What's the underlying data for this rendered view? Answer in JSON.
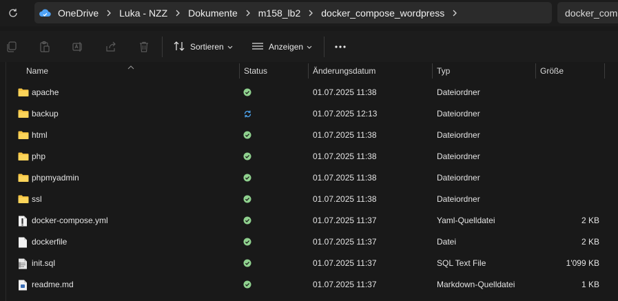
{
  "breadcrumb": [
    "OneDrive",
    "Luka - NZZ",
    "Dokumente",
    "m158_lb2",
    "docker_compose_wordpress"
  ],
  "search": {
    "placeholder": "docker_compose_wordpress durchsuchen"
  },
  "toolbar": {
    "sort_label": "Sortieren",
    "view_label": "Anzeigen"
  },
  "columns": {
    "name": "Name",
    "status": "Status",
    "date": "Änderungsdatum",
    "type": "Typ",
    "size": "Größe"
  },
  "files": [
    {
      "name": "apache",
      "icon": "folder-icon",
      "status": "synced",
      "date": "01.07.2025 11:38",
      "type": "Dateiordner",
      "size": ""
    },
    {
      "name": "backup",
      "icon": "folder-icon",
      "status": "syncing",
      "date": "01.07.2025 12:13",
      "type": "Dateiordner",
      "size": ""
    },
    {
      "name": "html",
      "icon": "folder-icon",
      "status": "synced",
      "date": "01.07.2025 11:38",
      "type": "Dateiordner",
      "size": ""
    },
    {
      "name": "php",
      "icon": "folder-icon",
      "status": "synced",
      "date": "01.07.2025 11:38",
      "type": "Dateiordner",
      "size": ""
    },
    {
      "name": "phpmyadmin",
      "icon": "folder-icon",
      "status": "synced",
      "date": "01.07.2025 11:38",
      "type": "Dateiordner",
      "size": ""
    },
    {
      "name": "ssl",
      "icon": "folder-icon",
      "status": "synced",
      "date": "01.07.2025 11:38",
      "type": "Dateiordner",
      "size": ""
    },
    {
      "name": "docker-compose.yml",
      "icon": "yaml-file-icon",
      "status": "synced",
      "date": "01.07.2025 11:37",
      "type": "Yaml-Quelldatei",
      "size": "2 KB"
    },
    {
      "name": "dockerfile",
      "icon": "file-icon",
      "status": "synced",
      "date": "01.07.2025 11:37",
      "type": "Datei",
      "size": "2 KB"
    },
    {
      "name": "init.sql",
      "icon": "sql-file-icon",
      "status": "synced",
      "date": "01.07.2025 11:37",
      "type": "SQL Text File",
      "size": "1'099 KB"
    },
    {
      "name": "readme.md",
      "icon": "markdown-file-icon",
      "status": "synced",
      "date": "01.07.2025 11:37",
      "type": "Markdown-Quelldatei",
      "size": "1 KB"
    }
  ],
  "colors": {
    "folder": "#f5c443",
    "synced": "#8fd18e",
    "syncing": "#4ea5f0",
    "cloud": "#4fa3f7"
  }
}
